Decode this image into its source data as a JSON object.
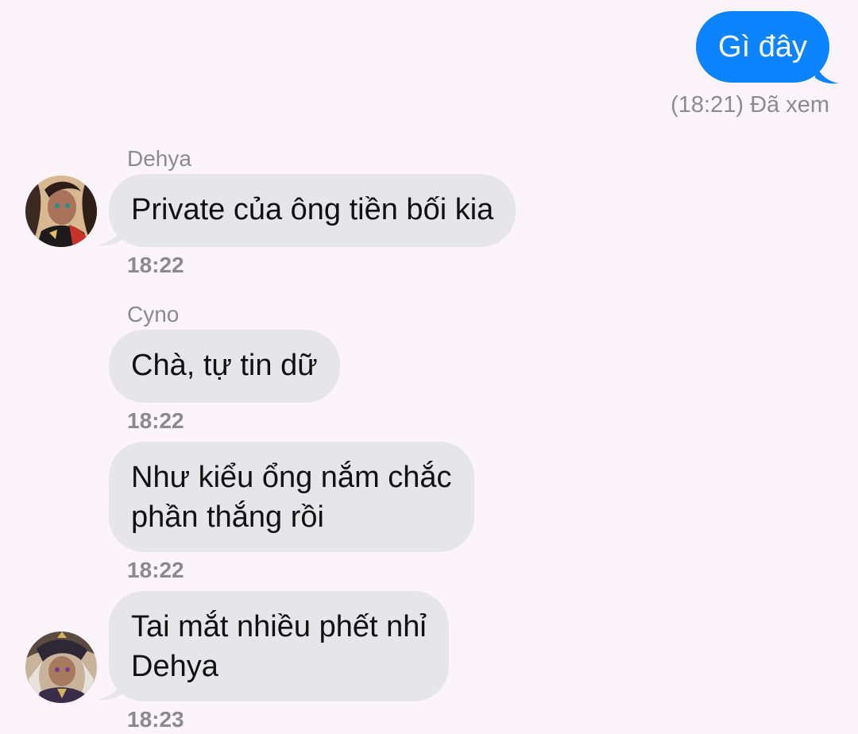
{
  "outgoing": {
    "text": "Gì đây",
    "receipt": "(18:21) Đã xem",
    "color": "#0b84fe"
  },
  "messages": [
    {
      "sender": "Dehya",
      "text": "Private của ông tiền bối kia",
      "time": "18:22",
      "avatar": "dehya-avatar"
    },
    {
      "sender": "Cyno",
      "text": "Chà, tự tin dữ",
      "time": "18:22"
    },
    {
      "text_line1": "Như kiểu ổng nắm chắc",
      "text_line2": "phần thắng rồi",
      "time": "18:22"
    },
    {
      "text_line1": "Tai mắt nhiều phết nhỉ",
      "text_line2": "Dehya",
      "time": "18:23",
      "avatar": "cyno-avatar"
    }
  ],
  "colors": {
    "background": "#fcf4fb",
    "incoming_bubble": "#e6e5ea",
    "meta_text": "#8b8a8f"
  }
}
